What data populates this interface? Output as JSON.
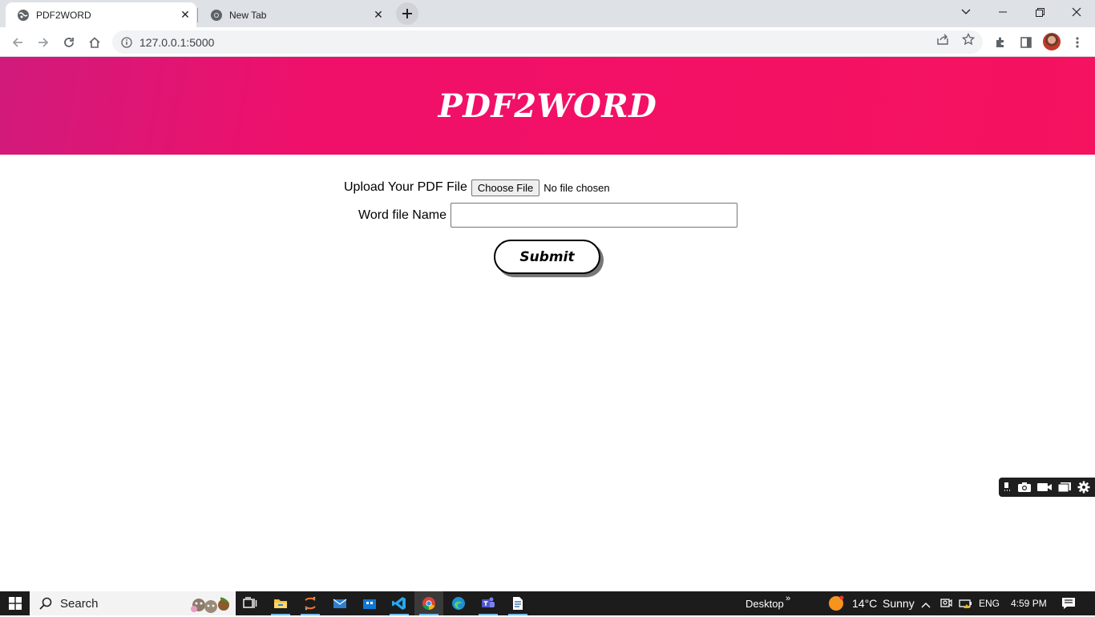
{
  "browser": {
    "tabs": [
      {
        "title": "PDF2WORD",
        "active": true
      },
      {
        "title": "New Tab",
        "active": false
      }
    ],
    "address": "127.0.0.1:5000",
    "icons": {
      "back": "arrow-left-icon",
      "forward": "arrow-right-icon",
      "reload": "reload-icon",
      "home": "home-icon",
      "site_info": "info-icon",
      "share": "share-icon",
      "bookmark": "star-icon",
      "extensions": "puzzle-icon",
      "side_panel": "side-panel-icon",
      "menu": "kebab-menu-icon"
    }
  },
  "page": {
    "header_title": "PDF2WORD",
    "header_gradient": [
      "#d11a7c",
      "#f0106a",
      "#f5125f"
    ],
    "upload_label": "Upload Your PDF File",
    "choose_file_button": "Choose File",
    "no_file_text": "No file chosen",
    "word_name_label": "Word file Name",
    "word_name_value": "",
    "submit_label": "Submit"
  },
  "taskbar": {
    "search_placeholder": "Search",
    "desktop_label": "Desktop",
    "weather_temp": "14°C",
    "weather_text": "Sunny",
    "language": "ENG",
    "time": "4:59 PM"
  }
}
